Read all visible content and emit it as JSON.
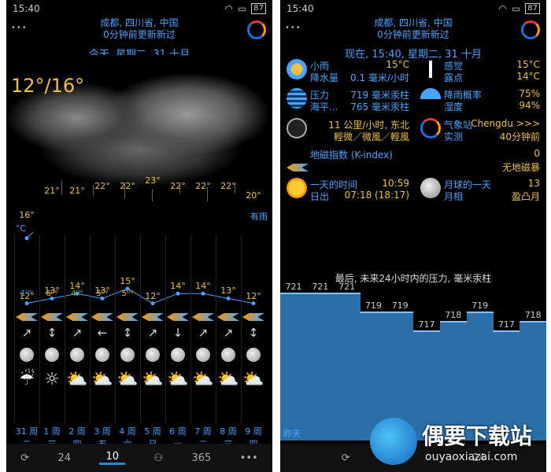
{
  "left": {
    "status": {
      "time": "15:40",
      "battery": "87"
    },
    "location": "成都, 四川省, 中国",
    "updated": "0分钟前更新新过",
    "date": "今天, 星期二, 31 十月",
    "temp_range": "12°/16°",
    "condition": "有雨",
    "unit": "°C",
    "days": [
      {
        "hi": "16°",
        "lo": "12°",
        "uv": "1",
        "uvc": "#4aa3ff",
        "arrow": "↗",
        "wx": "☔",
        "label": "31 周二"
      },
      {
        "hi": "21°",
        "lo": "13°",
        "uv": "6",
        "uvc": "#f0c040",
        "arrow": "↕",
        "wx": "☼",
        "label": "1 周三"
      },
      {
        "hi": "21°",
        "lo": "14°",
        "uv": "4",
        "uvc": "#8bc34a",
        "arrow": "↗",
        "wx": "⛅",
        "label": "2 周四"
      },
      {
        "hi": "22°",
        "lo": "13°",
        "uv": "5",
        "uvc": "#f0c040",
        "arrow": "←",
        "wx": "⛅",
        "label": "3 周五"
      },
      {
        "hi": "22°",
        "lo": "15°",
        "uv": "5",
        "uvc": "#f0c040",
        "arrow": "↕",
        "wx": "⛅",
        "label": "4 周六"
      },
      {
        "hi": "23°",
        "lo": "12°",
        "uv": "",
        "uvc": "#f0c040",
        "arrow": "↗",
        "wx": "⛅",
        "label": "5 周日"
      },
      {
        "hi": "22°",
        "lo": "14°",
        "uv": "",
        "uvc": "#f0c040",
        "arrow": "↓",
        "wx": "⛅",
        "label": "6 周一"
      },
      {
        "hi": "22°",
        "lo": "14°",
        "uv": "",
        "uvc": "#f0c040",
        "arrow": "↗",
        "wx": "⛅",
        "label": "7 周二"
      },
      {
        "hi": "22°",
        "lo": "13°",
        "uv": "",
        "uvc": "#f0c040",
        "arrow": "↗",
        "wx": "⛅",
        "label": "8 周三"
      },
      {
        "hi": "20°",
        "lo": "12°",
        "uv": "",
        "uvc": "#f0c040",
        "arrow": "↕",
        "wx": "⛅",
        "label": "9 周四"
      }
    ],
    "nav": [
      "⟳",
      "24",
      "10",
      "⚇",
      "365",
      "•••"
    ]
  },
  "right": {
    "status": {
      "time": "15:40",
      "battery": "87"
    },
    "location": "成都, 四川省, 中国",
    "updated": "0分钟前更新新过",
    "date": "现在, 15:40, 星期二, 31 十月",
    "rows": {
      "r1a_k": "小雨",
      "r1a_v": "15°C",
      "r1b_k": "降水量",
      "r1b_v": "0.1 毫米/小时",
      "r1c_k": "感觉",
      "r1c_v": "15°C",
      "r1d_k": "露点",
      "r1d_v": "14°C",
      "r2a_k": "压力",
      "r2a_v": "719 毫米汞柱",
      "r2b_k": "海平...",
      "r2b_v": "765 毫米汞柱",
      "r2c_k": "降雨概率",
      "r2c_v": "75%",
      "r2d_k": "湿度",
      "r2d_v": "94%",
      "r3a_v": "11 公里/小时, 东北",
      "r3b_v": "輕微／微風／輕風",
      "r3c_k": "气象站",
      "r3c_v": "Chengdu >>>",
      "r3d_k": "实测",
      "r3d_v": "40分钟前",
      "r4a_k": "地磁指数 (K-index)",
      "r4a_v": "0",
      "r4b_v": "无地磁暴",
      "r5a_k": "一天的时间",
      "r5a_v": "10:59",
      "r5b_k": "日出",
      "r5b_v": "07:18 (18:17)",
      "r5c_k": "月球的一天",
      "r5c_v": "13",
      "r5d_k": "月相",
      "r5d_v": "盈凸月"
    },
    "pressure_title": "最后, 未来24小时内的压力, 毫米汞柱",
    "pressure": [
      721,
      721,
      721,
      719,
      719,
      717,
      718,
      719,
      717,
      718
    ],
    "yesterday": "昨天",
    "nav": [
      "⟳",
      "24"
    ]
  },
  "watermark": {
    "brand": "偶要下载站",
    "url": "ouyaoxiazai.com"
  }
}
